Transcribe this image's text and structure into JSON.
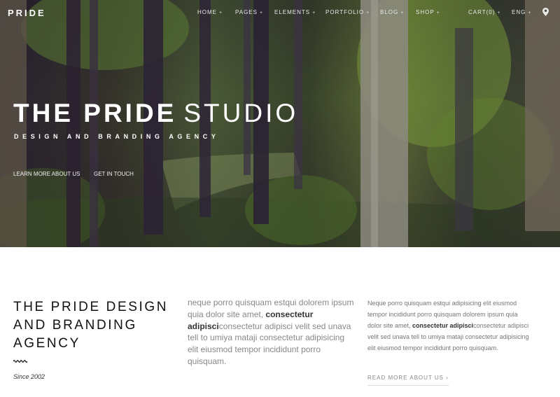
{
  "header": {
    "logo": "PRIDE",
    "nav": [
      {
        "label": "HOME",
        "suffix": "+"
      },
      {
        "label": "PAGES",
        "suffix": "+"
      },
      {
        "label": "ELEMENTS",
        "suffix": "+"
      },
      {
        "label": "PORTFOLIO",
        "suffix": "+"
      },
      {
        "label": "BLOG",
        "suffix": "+"
      },
      {
        "label": "SHOP",
        "suffix": "+"
      }
    ],
    "cart": {
      "label": "CART(0)",
      "suffix": "+"
    },
    "lang": {
      "label": "ENG",
      "suffix": "+"
    },
    "location_icon": "map-pin-icon"
  },
  "hero": {
    "title_strong": "THE PRIDE",
    "title_light": "STUDIO",
    "subtitle": "DESIGN AND BRANDING AGENCY",
    "links": [
      "LEARN MORE ABOUT US",
      "GET IN TOUCH"
    ]
  },
  "about": {
    "title": "THE PRIDE DESIGN AND BRANDING AGENCY",
    "since": "Since 2002",
    "lead_before": "neque porro quisquam estqui dolorem ipsum quia dolor site amet, ",
    "lead_bold": "consectetur adipisci",
    "lead_after": "consectetur adipisci velit sed unava tell to umiya mataji consectetur adipisicing elit eiusmod tempor incididunt porro quisquam.",
    "text_before": "Neque porro quisquam estqui adipisicing elit eiusmod tempor incididunt porro quisquam dolorem ipsum quia dolor site amet, ",
    "text_bold": "consectetur adipisci",
    "text_after": "consectetur adipisci velit sed unava tell to umiya mataji consectetur adipisicing elit eiusmod tempor incididunt porro quisquam.",
    "read_more": "READ MORE ABOUT US",
    "read_more_arrow": "›"
  },
  "colors": {
    "title": "#111111",
    "lead_text": "#888888",
    "body_text": "#777777",
    "hero_text": "#ffffff"
  }
}
